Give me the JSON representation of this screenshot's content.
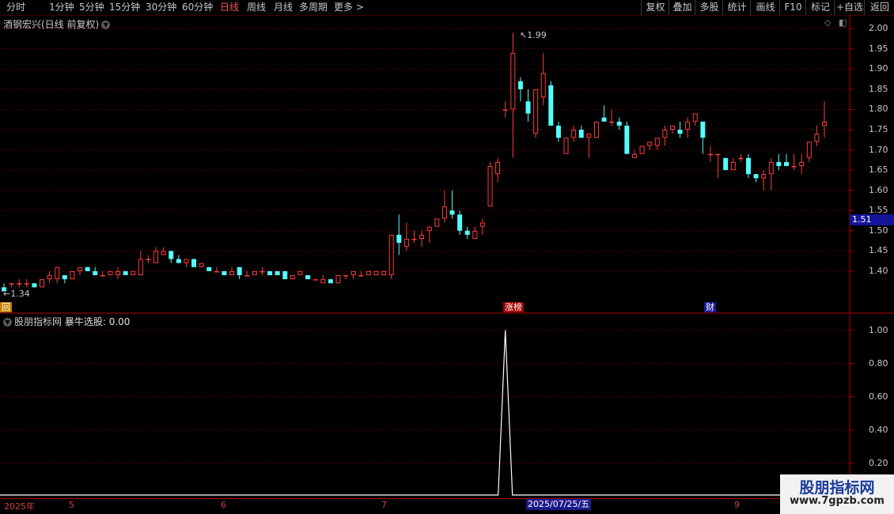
{
  "toolbar": {
    "left": [
      "分时",
      "1分钟",
      "5分钟",
      "15分钟",
      "30分钟",
      "60分钟",
      "日线",
      "周线",
      "月线",
      "多周期",
      "更多 >"
    ],
    "active": "日线",
    "right": [
      "复权",
      "叠加",
      "多股",
      "统计",
      "画线",
      "F10",
      "标记",
      "+自选",
      "返回"
    ]
  },
  "main": {
    "title": "酒钢宏兴(日线 前复权)",
    "high_label": "1.99",
    "low_label": "1.34",
    "y_ticks": [
      "2.00",
      "1.95",
      "1.90",
      "1.85",
      "1.80",
      "1.75",
      "1.70",
      "1.65",
      "1.60",
      "1.55",
      "1.50",
      "1.45",
      "1.40"
    ],
    "current_price": "1.51",
    "badges": [
      "涨榜",
      "财"
    ],
    "left_marker": "回"
  },
  "indicator": {
    "title": "股朋指标网",
    "label": "暴牛选股: 0.00",
    "y_ticks": [
      "1.00",
      "0.80",
      "0.60",
      "0.40",
      "0.20"
    ]
  },
  "date_axis": {
    "labels": [
      "2025年",
      "5",
      "6",
      "7",
      "9"
    ],
    "selected": "2025/07/25/五"
  },
  "watermark": {
    "title": "股朋指标网",
    "url": "www.7gpzb.com"
  },
  "colors": {
    "up": "#ff3c3c",
    "down": "#54fcfc",
    "grid": "#8b0000",
    "signal": "#ffffff"
  },
  "chart_data": {
    "type": "candlestick",
    "y_range": [
      1.3,
      2.02
    ],
    "candles": [
      [
        1.36,
        1.37,
        1.35,
        1.35
      ],
      [
        1.37,
        1.37,
        1.36,
        1.37
      ],
      [
        1.37,
        1.38,
        1.36,
        1.37
      ],
      [
        1.37,
        1.38,
        1.36,
        1.37
      ],
      [
        1.37,
        1.37,
        1.36,
        1.36
      ],
      [
        1.36,
        1.38,
        1.36,
        1.38
      ],
      [
        1.38,
        1.4,
        1.37,
        1.39
      ],
      [
        1.38,
        1.41,
        1.37,
        1.41
      ],
      [
        1.39,
        1.39,
        1.37,
        1.38
      ],
      [
        1.38,
        1.4,
        1.38,
        1.4
      ],
      [
        1.4,
        1.41,
        1.39,
        1.41
      ],
      [
        1.41,
        1.41,
        1.4,
        1.4
      ],
      [
        1.4,
        1.41,
        1.39,
        1.39
      ],
      [
        1.39,
        1.4,
        1.39,
        1.39
      ],
      [
        1.39,
        1.4,
        1.39,
        1.4
      ],
      [
        1.39,
        1.41,
        1.38,
        1.4
      ],
      [
        1.4,
        1.4,
        1.39,
        1.39
      ],
      [
        1.39,
        1.4,
        1.39,
        1.4
      ],
      [
        1.39,
        1.45,
        1.39,
        1.43
      ],
      [
        1.43,
        1.44,
        1.42,
        1.43
      ],
      [
        1.42,
        1.46,
        1.42,
        1.45
      ],
      [
        1.44,
        1.46,
        1.44,
        1.45
      ],
      [
        1.45,
        1.45,
        1.42,
        1.43
      ],
      [
        1.43,
        1.44,
        1.42,
        1.42
      ],
      [
        1.42,
        1.43,
        1.41,
        1.43
      ],
      [
        1.43,
        1.43,
        1.41,
        1.41
      ],
      [
        1.41,
        1.42,
        1.41,
        1.42
      ],
      [
        1.41,
        1.41,
        1.4,
        1.4
      ],
      [
        1.4,
        1.41,
        1.4,
        1.4
      ],
      [
        1.4,
        1.4,
        1.39,
        1.39
      ],
      [
        1.39,
        1.41,
        1.39,
        1.4
      ],
      [
        1.41,
        1.41,
        1.38,
        1.39
      ],
      [
        1.39,
        1.4,
        1.39,
        1.39
      ],
      [
        1.39,
        1.4,
        1.39,
        1.4
      ],
      [
        1.4,
        1.41,
        1.39,
        1.4
      ],
      [
        1.4,
        1.4,
        1.39,
        1.39
      ],
      [
        1.4,
        1.4,
        1.39,
        1.39
      ],
      [
        1.4,
        1.4,
        1.38,
        1.38
      ],
      [
        1.38,
        1.39,
        1.38,
        1.39
      ],
      [
        1.39,
        1.4,
        1.39,
        1.4
      ],
      [
        1.39,
        1.39,
        1.38,
        1.38
      ],
      [
        1.38,
        1.38,
        1.38,
        1.38
      ],
      [
        1.37,
        1.39,
        1.37,
        1.38
      ],
      [
        1.38,
        1.38,
        1.37,
        1.37
      ],
      [
        1.37,
        1.39,
        1.37,
        1.39
      ],
      [
        1.39,
        1.39,
        1.38,
        1.39
      ],
      [
        1.39,
        1.4,
        1.38,
        1.4
      ],
      [
        1.39,
        1.4,
        1.39,
        1.39
      ],
      [
        1.39,
        1.4,
        1.39,
        1.4
      ],
      [
        1.39,
        1.4,
        1.39,
        1.4
      ],
      [
        1.39,
        1.4,
        1.39,
        1.4
      ],
      [
        1.39,
        1.49,
        1.38,
        1.49
      ],
      [
        1.49,
        1.54,
        1.44,
        1.47
      ],
      [
        1.46,
        1.52,
        1.45,
        1.48
      ],
      [
        1.48,
        1.5,
        1.47,
        1.48
      ],
      [
        1.48,
        1.5,
        1.46,
        1.49
      ],
      [
        1.5,
        1.51,
        1.47,
        1.51
      ],
      [
        1.51,
        1.53,
        1.51,
        1.53
      ],
      [
        1.53,
        1.6,
        1.52,
        1.56
      ],
      [
        1.55,
        1.6,
        1.53,
        1.54
      ],
      [
        1.54,
        1.55,
        1.49,
        1.5
      ],
      [
        1.5,
        1.51,
        1.48,
        1.49
      ],
      [
        1.48,
        1.51,
        1.48,
        1.5
      ],
      [
        1.51,
        1.53,
        1.49,
        1.52
      ],
      [
        1.56,
        1.67,
        1.56,
        1.66
      ],
      [
        1.64,
        1.68,
        1.62,
        1.67
      ],
      [
        1.8,
        1.82,
        1.78,
        1.8
      ],
      [
        1.8,
        1.99,
        1.68,
        1.94
      ],
      [
        1.87,
        1.88,
        1.82,
        1.85
      ],
      [
        1.82,
        1.85,
        1.77,
        1.79
      ],
      [
        1.74,
        1.85,
        1.73,
        1.85
      ],
      [
        1.83,
        1.94,
        1.81,
        1.89
      ],
      [
        1.86,
        1.87,
        1.76,
        1.76
      ],
      [
        1.76,
        1.77,
        1.72,
        1.73
      ],
      [
        1.69,
        1.73,
        1.69,
        1.73
      ],
      [
        1.73,
        1.76,
        1.72,
        1.75
      ],
      [
        1.75,
        1.76,
        1.73,
        1.73
      ],
      [
        1.73,
        1.74,
        1.68,
        1.74
      ],
      [
        1.73,
        1.77,
        1.73,
        1.77
      ],
      [
        1.78,
        1.81,
        1.77,
        1.77
      ],
      [
        1.77,
        1.8,
        1.76,
        1.77
      ],
      [
        1.77,
        1.78,
        1.75,
        1.76
      ],
      [
        1.76,
        1.77,
        1.69,
        1.69
      ],
      [
        1.68,
        1.7,
        1.68,
        1.69
      ],
      [
        1.69,
        1.71,
        1.69,
        1.71
      ],
      [
        1.71,
        1.72,
        1.7,
        1.72
      ],
      [
        1.71,
        1.73,
        1.7,
        1.73
      ],
      [
        1.73,
        1.76,
        1.71,
        1.75
      ],
      [
        1.75,
        1.76,
        1.74,
        1.76
      ],
      [
        1.75,
        1.77,
        1.73,
        1.74
      ],
      [
        1.75,
        1.78,
        1.73,
        1.77
      ],
      [
        1.77,
        1.79,
        1.76,
        1.79
      ],
      [
        1.77,
        1.77,
        1.69,
        1.73
      ],
      [
        1.69,
        1.71,
        1.67,
        1.69
      ],
      [
        1.69,
        1.69,
        1.63,
        1.69
      ],
      [
        1.68,
        1.68,
        1.65,
        1.65
      ],
      [
        1.65,
        1.68,
        1.66,
        1.67
      ],
      [
        1.68,
        1.69,
        1.67,
        1.68
      ],
      [
        1.68,
        1.69,
        1.63,
        1.64
      ],
      [
        1.64,
        1.64,
        1.62,
        1.63
      ],
      [
        1.63,
        1.65,
        1.6,
        1.64
      ],
      [
        1.64,
        1.68,
        1.6,
        1.67
      ],
      [
        1.67,
        1.69,
        1.65,
        1.66
      ],
      [
        1.67,
        1.69,
        1.66,
        1.66
      ],
      [
        1.66,
        1.69,
        1.65,
        1.66
      ],
      [
        1.66,
        1.69,
        1.64,
        1.67
      ],
      [
        1.68,
        1.72,
        1.67,
        1.72
      ],
      [
        1.72,
        1.76,
        1.71,
        1.74
      ],
      [
        1.76,
        1.82,
        1.73,
        1.77
      ]
    ],
    "signal": {
      "name": "暴牛选股",
      "y_range": [
        0,
        1.05
      ],
      "spike_index": 66,
      "spike_value": 1.0
    }
  }
}
